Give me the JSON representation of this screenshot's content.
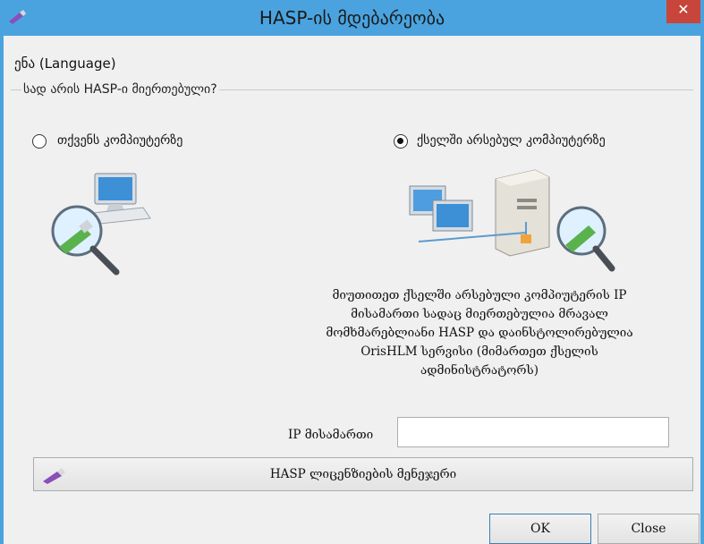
{
  "window": {
    "title": "HASP-ის მდებარეობა",
    "close_glyph": "✕",
    "accent_color": "#4aa3df",
    "close_color": "#c7453a"
  },
  "menu": {
    "language": "ენა (Language)"
  },
  "group": {
    "legend": "სად არის HASP-ი მიერთებული?"
  },
  "options": {
    "local": {
      "label": "თქვენს კომპიუტერზე",
      "selected": false
    },
    "network": {
      "label": "ქსელში არსებულ კომპიუტერზე",
      "selected": true
    }
  },
  "description": {
    "lines": [
      "მიუთითეთ ქსელში არსებული კომპიუტერის IP",
      "მისამართი სადაც მიერთებულია მრავალ",
      "მომხმარებლიანი HASP და დაინსტოლირებულია",
      "OrisHLM სერვისი (მიმართეთ ქსელის",
      "ადმინისტრატორს)"
    ]
  },
  "ip": {
    "label": "IP მისამართი",
    "value": ""
  },
  "buttons": {
    "license_manager": "HASP ლიცენზიების მენეჯერი",
    "ok": "OK",
    "close": "Close"
  },
  "icons": {
    "app": "usb-key-icon",
    "local_picture": "computer-with-magnifier-icon",
    "network_picture": "network-server-icon",
    "license_button": "usb-key-icon"
  }
}
